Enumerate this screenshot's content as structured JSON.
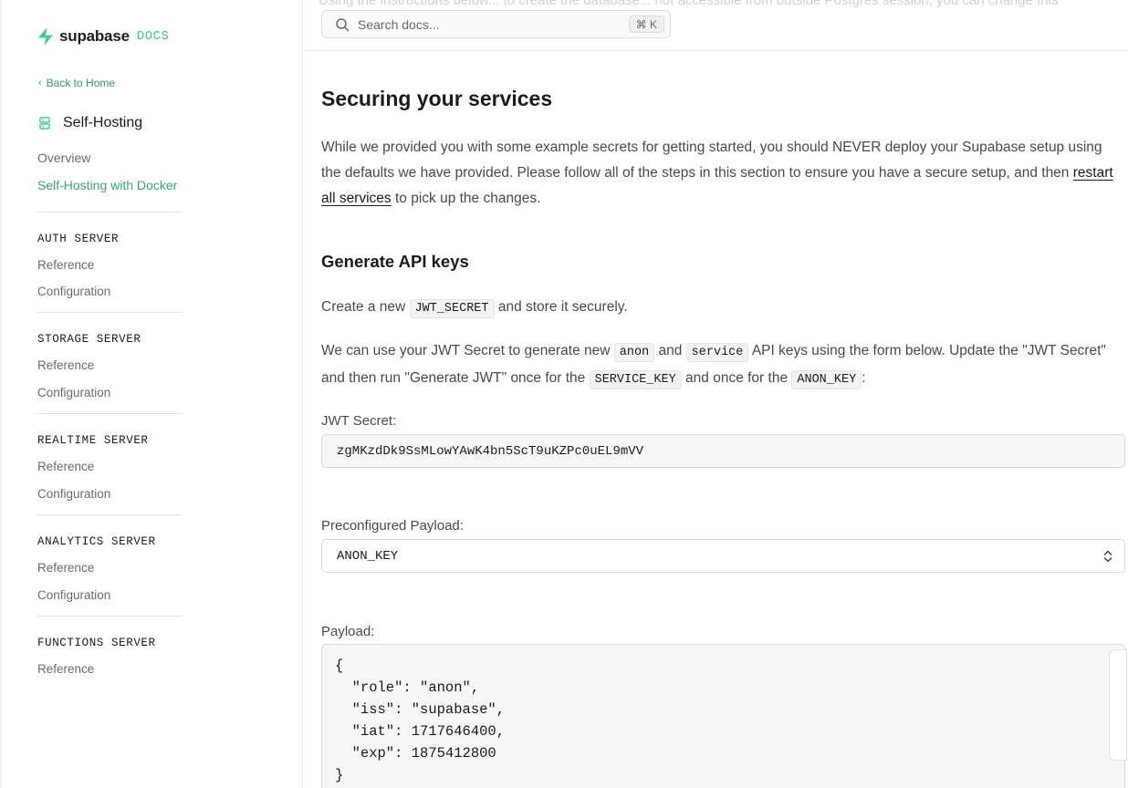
{
  "brand": {
    "name": "supabase",
    "docs": "DOCS",
    "accent": "#3ecf8e"
  },
  "sidebar": {
    "back_label": "Back to Home",
    "section_title": "Self-Hosting",
    "links": [
      "Overview",
      "Self-Hosting with Docker"
    ],
    "groups": [
      {
        "label": "AUTH SERVER",
        "items": [
          "Reference",
          "Configuration"
        ]
      },
      {
        "label": "STORAGE SERVER",
        "items": [
          "Reference",
          "Configuration"
        ]
      },
      {
        "label": "REALTIME SERVER",
        "items": [
          "Reference",
          "Configuration"
        ]
      },
      {
        "label": "ANALYTICS SERVER",
        "items": [
          "Reference",
          "Configuration"
        ]
      },
      {
        "label": "FUNCTIONS SERVER",
        "items": [
          "Reference"
        ]
      }
    ]
  },
  "header": {
    "scrolled_text": "Using the instructions below... to create the database... not accessible from outside Postgres session, you can change this",
    "search_placeholder": "Search docs...",
    "search_shortcut": "⌘ K"
  },
  "content": {
    "title": "Securing your services",
    "intro_before": "While we provided you with some example secrets for getting started, you should NEVER deploy your Supabase setup using the defaults we have provided. Please follow all of the steps in this section to ensure you have a secure setup, and then ",
    "intro_link": "restart all services",
    "intro_after": " to pick up the changes.",
    "subtitle": "Generate API keys",
    "p1_before": "Create a new ",
    "p1_code": "JWT_SECRET",
    "p1_after": " and store it securely.",
    "p2_a": "We can use your JWT Secret to generate new ",
    "p2_code1": "anon",
    "p2_b": " and ",
    "p2_code2": "service",
    "p2_c": " API keys using the form below. Update the \"JWT Secret\" and then run \"Generate JWT\" once for the ",
    "p2_code3": "SERVICE_KEY",
    "p2_d": " and once for the ",
    "p2_code4": "ANON_KEY",
    "p2_e": ":",
    "jwt_label": "JWT Secret:",
    "jwt_value": "zgMKzdDk9SsMLowYAwK4bn5ScT9uKZPc0uEL9mVV",
    "payload_select_label": "Preconfigured Payload:",
    "payload_select_value": "ANON_KEY",
    "payload_label": "Payload:",
    "payload_value": "{\n  \"role\": \"anon\",\n  \"iss\": \"supabase\",\n  \"iat\": 1717646400,\n  \"exp\": 1875412800\n}"
  }
}
